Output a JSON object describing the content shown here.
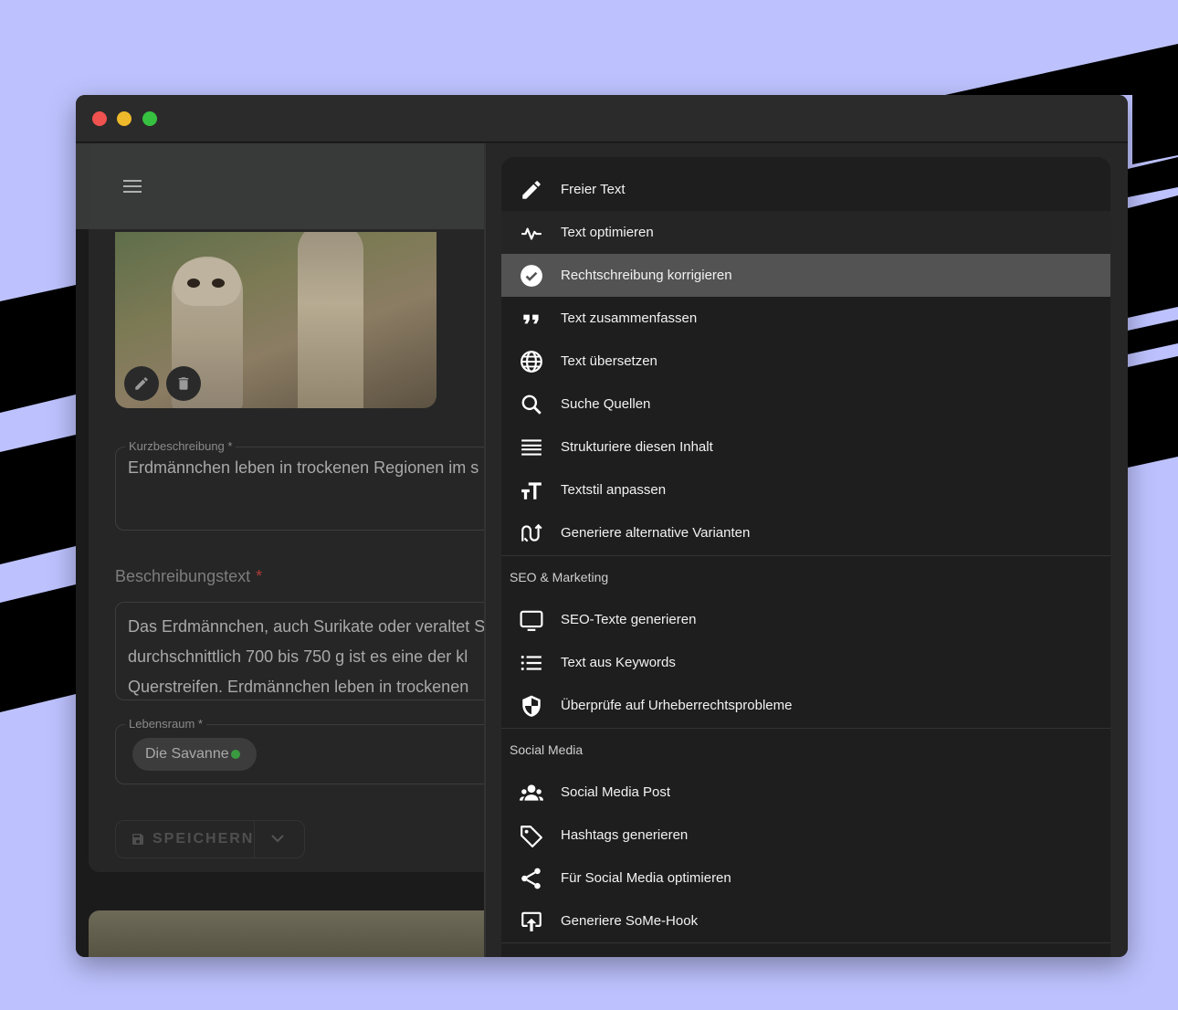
{
  "window": {
    "controls": [
      "close",
      "minimize",
      "maximize"
    ]
  },
  "editor": {
    "photo_actions": [
      "edit-icon",
      "delete-icon"
    ],
    "kurzbeschreibung": {
      "label": "Kurzbeschreibung *",
      "value": "Erdmännchen leben in trockenen Regionen im s"
    },
    "beschreibung": {
      "label": "Beschreibungstext",
      "required_mark": "*",
      "lines": [
        "Das Erdmännchen, auch Surikate oder veraltet S",
        "durchschnittlich 700 bis 750 g ist es eine der kl",
        "Querstreifen. Erdmännchen leben in trockenen"
      ]
    },
    "lebensraum": {
      "label": "Lebensraum *",
      "chip": "Die Savanne"
    },
    "save_label": "SPEICHERN"
  },
  "menu": {
    "items": [
      {
        "label": "Freier Text",
        "icon": "pencil-icon"
      },
      {
        "label": "Text optimieren",
        "icon": "pulse-icon"
      },
      {
        "label": "Rechtschreibung korrigieren",
        "icon": "check-circle-icon"
      },
      {
        "label": "Text zusammenfassen",
        "icon": "quote-icon"
      },
      {
        "label": "Text übersetzen",
        "icon": "globe-icon"
      },
      {
        "label": "Suche Quellen",
        "icon": "search-icon"
      },
      {
        "label": "Strukturiere diesen Inhalt",
        "icon": "lines-icon"
      },
      {
        "label": "Textstil anpassen",
        "icon": "text-size-icon"
      },
      {
        "label": "Generiere alternative Varianten",
        "icon": "variants-icon"
      }
    ],
    "seo_title": "SEO & Marketing",
    "seo_items": [
      {
        "label": "SEO-Texte generieren",
        "icon": "monitor-icon"
      },
      {
        "label": "Text aus Keywords",
        "icon": "list-icon"
      },
      {
        "label": "Überprüfe auf Urheberrechtsprobleme",
        "icon": "shield-icon"
      }
    ],
    "social_title": "Social Media",
    "social_items": [
      {
        "label": "Social Media Post",
        "icon": "group-icon"
      },
      {
        "label": "Hashtags generieren",
        "icon": "tag-icon"
      },
      {
        "label": "Für Social Media optimieren",
        "icon": "share-icon"
      },
      {
        "label": "Generiere SoMe-Hook",
        "icon": "upload-icon"
      }
    ]
  },
  "colors": {
    "background": "#bdc2fe",
    "menu_bg": "#1e1e1e",
    "active_item": "#535353",
    "required": "#b03a3a",
    "chip_dot": "#3a9a3f"
  }
}
